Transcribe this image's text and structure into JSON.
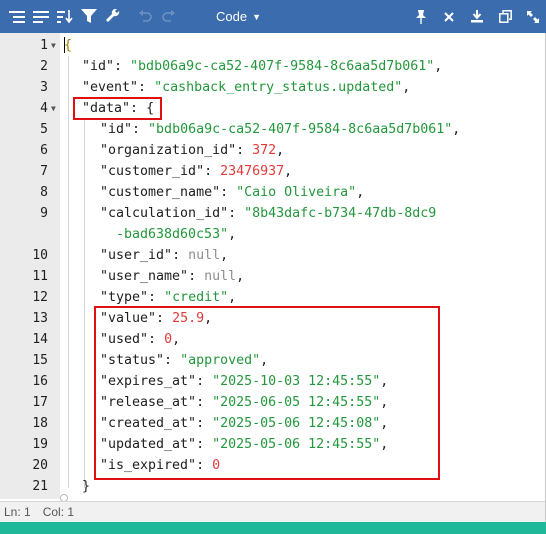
{
  "toolbar": {
    "mode_label": "Code",
    "icons": [
      "format-icon",
      "compact-icon",
      "sort-icon",
      "filter-icon",
      "repair-icon",
      "undo-icon",
      "redo-icon"
    ],
    "right_icons": [
      "pin-icon",
      "close-icon",
      "download-icon",
      "copy-icon",
      "expand-icon"
    ]
  },
  "editor": {
    "lines": [
      {
        "num": "1",
        "fold": true
      },
      {
        "num": "2"
      },
      {
        "num": "3"
      },
      {
        "num": "4",
        "fold": true
      },
      {
        "num": "5"
      },
      {
        "num": "6"
      },
      {
        "num": "7"
      },
      {
        "num": "8"
      },
      {
        "num": "9"
      },
      {
        "num": "10"
      },
      {
        "num": "11"
      },
      {
        "num": "12"
      },
      {
        "num": "13"
      },
      {
        "num": "14"
      },
      {
        "num": "15"
      },
      {
        "num": "16"
      },
      {
        "num": "17"
      },
      {
        "num": "18"
      },
      {
        "num": "19"
      },
      {
        "num": "20"
      },
      {
        "num": "21"
      }
    ],
    "text": {
      "open_brace": "{",
      "id_key": "\"id\"",
      "id_val": "\"bdb06a9c-ca52-407f-9584-8c6aa5d7b061\"",
      "event_key": "\"event\"",
      "event_val": "\"cashback_entry_status.updated\"",
      "data_key": "\"data\"",
      "data_open": "{",
      "d_id_key": "\"id\"",
      "d_id_val": "\"bdb06a9c-ca52-407f-9584-8c6aa5d7b061\"",
      "org_key": "\"organization_id\"",
      "org_val": "372",
      "cust_key": "\"customer_id\"",
      "cust_val": "23476937",
      "cname_key": "\"customer_name\"",
      "cname_val": "\"Caio Oliveira\"",
      "calc_key": "\"calculation_id\"",
      "calc_val_1": "\"8b43dafc-b734-47db-8dc9",
      "calc_val_2": "-bad638d60c53\"",
      "uid_key": "\"user_id\"",
      "uid_val": "null",
      "uname_key": "\"user_name\"",
      "uname_val": "null",
      "type_key": "\"type\"",
      "type_val": "\"credit\"",
      "value_key": "\"value\"",
      "value_val": "25.9",
      "used_key": "\"used\"",
      "used_val": "0",
      "status_key": "\"status\"",
      "status_val": "\"approved\"",
      "exp_key": "\"expires_at\"",
      "exp_val": "\"2025-10-03 12:45:55\"",
      "rel_key": "\"release_at\"",
      "rel_val": "\"2025-06-05 12:45:55\"",
      "cre_key": "\"created_at\"",
      "cre_val": "\"2025-05-06 12:45:08\"",
      "upd_key": "\"updated_at\"",
      "upd_val": "\"2025-05-06 12:45:55\"",
      "isexp_key": "\"is_expired\"",
      "isexp_val": "0",
      "close_brace": "}"
    }
  },
  "statusbar": {
    "line": "Ln: 1",
    "col": "Col: 1"
  },
  "colors": {
    "toolbar": "#3b6cae",
    "string": "#23973c",
    "number": "#e03b3b",
    "null": "#8f8f8f",
    "highlight_box": "#e01010",
    "background": "#1fb99a"
  }
}
